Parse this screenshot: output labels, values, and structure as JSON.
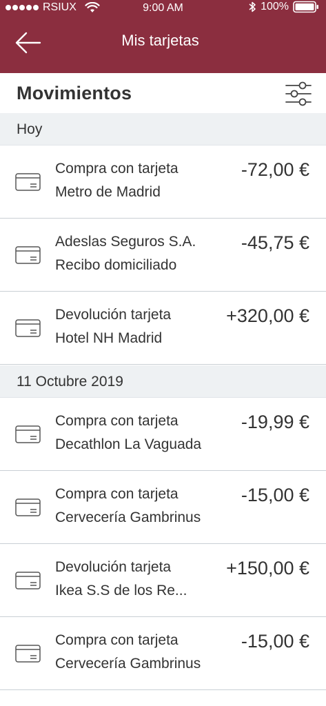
{
  "status_bar": {
    "carrier": "RSIUX",
    "time": "9:00 AM",
    "battery": "100%"
  },
  "nav": {
    "title": "Mis tarjetas",
    "back_icon": "arrow-left-icon"
  },
  "section": {
    "title": "Movimientos",
    "filter_icon": "sliders-icon"
  },
  "groups": [
    {
      "label": "Hoy",
      "items": [
        {
          "line1": "Compra con tarjeta",
          "line2": "Metro de Madrid",
          "amount": "-72,00 €"
        },
        {
          "line1": "Adeslas Seguros S.A.",
          "line2": "Recibo domiciliado",
          "amount": "-45,75 €"
        },
        {
          "line1": "Devolución tarjeta",
          "line2": "Hotel NH Madrid",
          "amount": "+320,00 €"
        }
      ]
    },
    {
      "label": "11 Octubre 2019",
      "items": [
        {
          "line1": "Compra con tarjeta",
          "line2": "Decathlon La Vaguada",
          "amount": "-19,99 €"
        },
        {
          "line1": "Compra con tarjeta",
          "line2": "Cervecería Gambrinus",
          "amount": "-15,00 €"
        },
        {
          "line1": "Devolución tarjeta",
          "line2": "Ikea S.S de los Re...",
          "amount": "+150,00 €"
        },
        {
          "line1": "Compra con tarjeta",
          "line2": "Cervecería Gambrinus",
          "amount": "-15,00 €"
        }
      ]
    }
  ],
  "colors": {
    "header_bg": "#8b2e3f",
    "group_bg": "#eef1f3",
    "text": "#333333"
  }
}
